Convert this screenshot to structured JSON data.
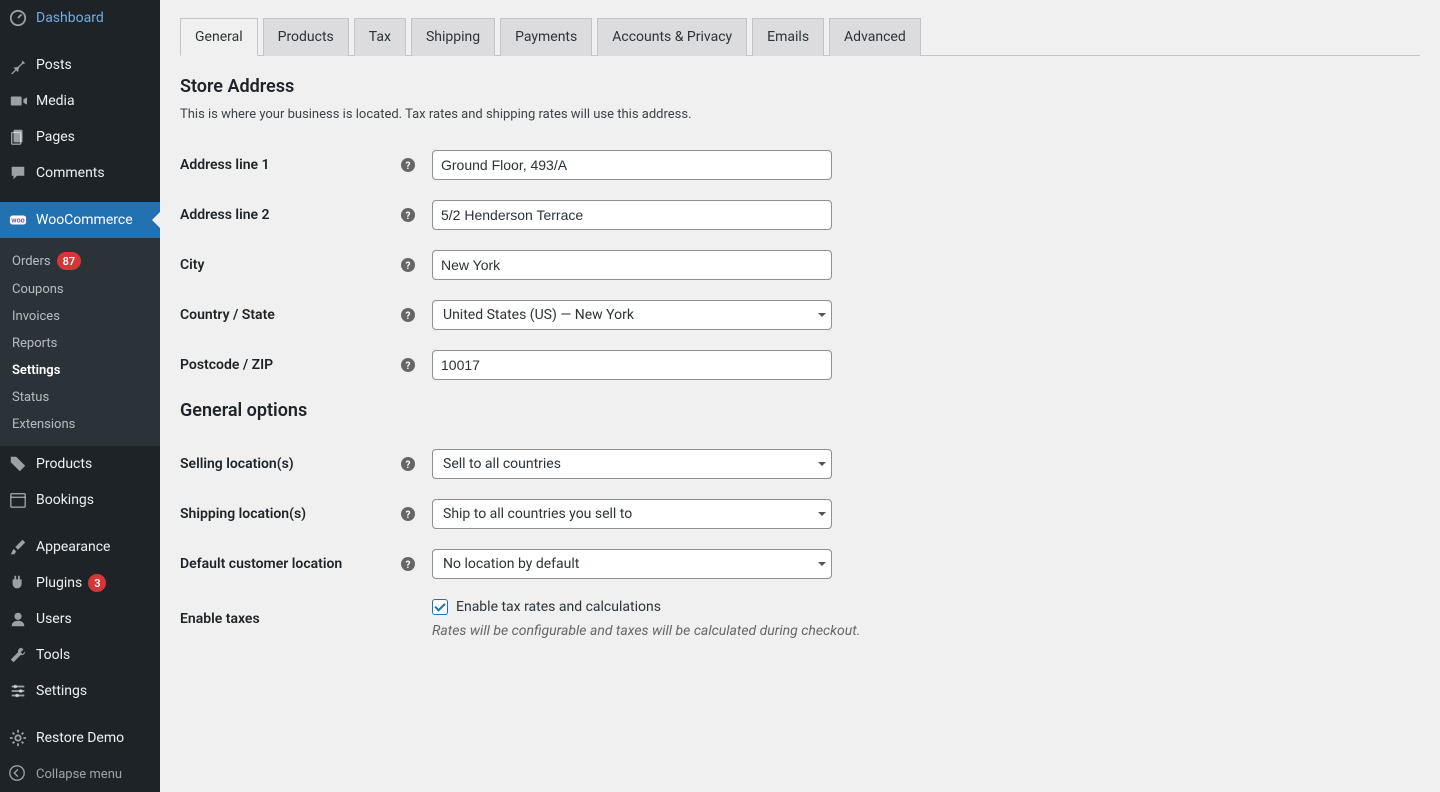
{
  "sidebar": {
    "items": [
      {
        "label": "Dashboard"
      },
      {
        "label": "Posts"
      },
      {
        "label": "Media"
      },
      {
        "label": "Pages"
      },
      {
        "label": "Comments"
      },
      {
        "label": "WooCommerce"
      },
      {
        "label": "Products"
      },
      {
        "label": "Bookings"
      },
      {
        "label": "Appearance"
      },
      {
        "label": "Plugins",
        "badge": "3"
      },
      {
        "label": "Users"
      },
      {
        "label": "Tools"
      },
      {
        "label": "Settings"
      },
      {
        "label": "Restore Demo"
      }
    ],
    "submenu": [
      {
        "label": "Orders",
        "badge": "87"
      },
      {
        "label": "Coupons"
      },
      {
        "label": "Invoices"
      },
      {
        "label": "Reports"
      },
      {
        "label": "Settings"
      },
      {
        "label": "Status"
      },
      {
        "label": "Extensions"
      }
    ],
    "collapse_label": "Collapse menu"
  },
  "tabs": [
    "General",
    "Products",
    "Tax",
    "Shipping",
    "Payments",
    "Accounts & Privacy",
    "Emails",
    "Advanced"
  ],
  "sections": {
    "store_address": {
      "title": "Store Address",
      "description": "This is where your business is located. Tax rates and shipping rates will use this address."
    },
    "general_options": {
      "title": "General options"
    }
  },
  "fields": {
    "address1": {
      "label": "Address line 1",
      "value": "Ground Floor, 493/A"
    },
    "address2": {
      "label": "Address line 2",
      "value": "5/2 Henderson Terrace"
    },
    "city": {
      "label": "City",
      "value": "New York"
    },
    "country_state": {
      "label": "Country / State",
      "value": "United States (US) — New York"
    },
    "postcode": {
      "label": "Postcode / ZIP",
      "value": "10017"
    },
    "selling_locations": {
      "label": "Selling location(s)",
      "value": "Sell to all countries"
    },
    "shipping_locations": {
      "label": "Shipping location(s)",
      "value": "Ship to all countries you sell to"
    },
    "default_customer_location": {
      "label": "Default customer location",
      "value": "No location by default"
    },
    "enable_taxes": {
      "label": "Enable taxes",
      "checkbox_label": "Enable tax rates and calculations",
      "helper": "Rates will be configurable and taxes will be calculated during checkout."
    }
  }
}
